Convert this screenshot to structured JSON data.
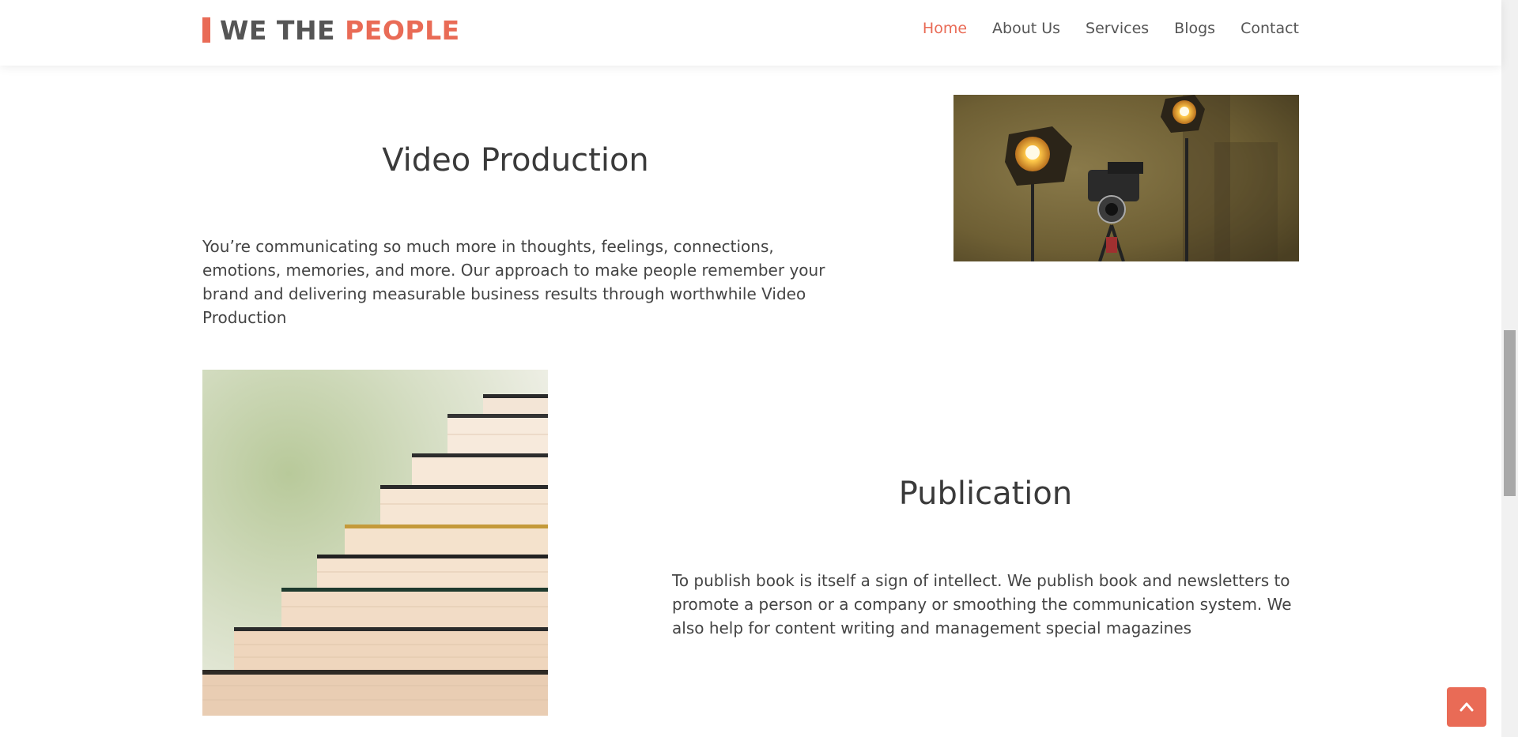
{
  "brand": {
    "part1": "WE THE",
    "part2": "PEOPLE",
    "accent_color": "#e96b56"
  },
  "nav": {
    "items": [
      {
        "label": "Home",
        "active": true
      },
      {
        "label": "About Us",
        "active": false
      },
      {
        "label": "Services",
        "active": false
      },
      {
        "label": "Blogs",
        "active": false
      },
      {
        "label": "Contact",
        "active": false
      }
    ]
  },
  "sections": [
    {
      "title": "Video Production",
      "text": "You’re communicating so much more in thoughts, feelings, connections, emotions, memories, and more. Our approach to make people remember your brand and delivering measurable business results through worthwhile Video Production",
      "image": "video-lights-camera-photo"
    },
    {
      "title": "Publication",
      "text": "To publish book is itself a sign of intellect. We publish book and newsletters to promote a person or a company or smoothing the communication system. We also help for content writing and management special magazines",
      "image": "stacked-books-photo"
    }
  ],
  "back_to_top": {
    "icon": "chevron-up-icon"
  }
}
